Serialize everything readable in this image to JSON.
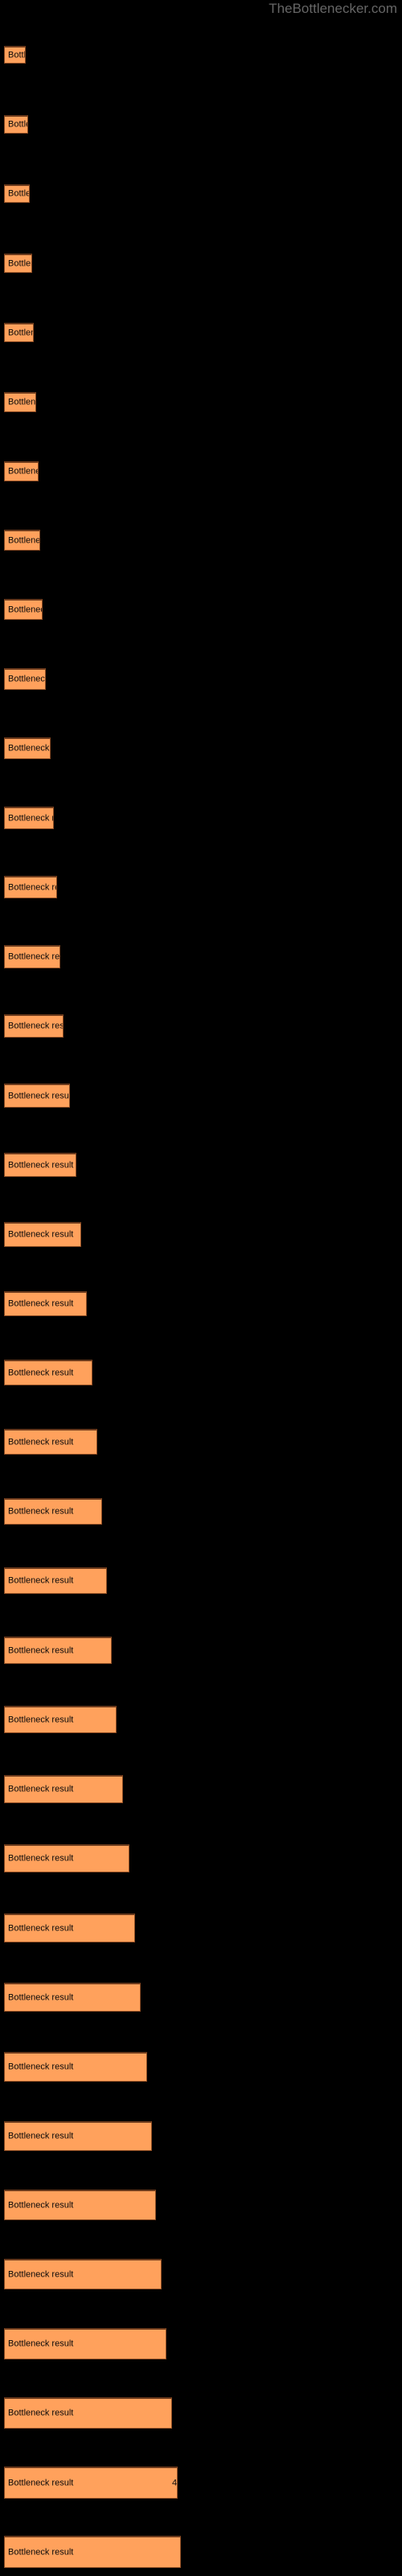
{
  "watermark": "TheBottlenecker.com",
  "colors": {
    "background": "#000000",
    "bar_fill": "#ffa15c",
    "bar_border": "#8a4a22",
    "bar_top_border": "#6b3a1c",
    "label_text": "#0a0a0a",
    "watermark_text": "#666666"
  },
  "chart_data": {
    "type": "bar",
    "orientation": "horizontal",
    "title": "",
    "subtitle": "",
    "xlabel": "",
    "ylabel": "",
    "grid": false,
    "legend": null,
    "axis_labels_visible": false,
    "categories": [
      "Bottleneck result",
      "Bottleneck result",
      "Bottleneck result",
      "Bottleneck result",
      "Bottleneck result",
      "Bottleneck result",
      "Bottleneck result",
      "Bottleneck result",
      "Bottleneck result",
      "Bottleneck result",
      "Bottleneck result",
      "Bottleneck result",
      "Bottleneck result",
      "Bottleneck result",
      "Bottleneck result",
      "Bottleneck result",
      "Bottleneck result",
      "Bottleneck result",
      "Bottleneck result",
      "Bottleneck result",
      "Bottleneck result",
      "Bottleneck result",
      "Bottleneck result",
      "Bottleneck result",
      "Bottleneck result",
      "Bottleneck result",
      "Bottleneck result",
      "Bottleneck result",
      "Bottleneck result",
      "Bottleneck result",
      "Bottleneck result",
      "Bottleneck result",
      "Bottleneck result",
      "Bottleneck result",
      "Bottleneck result",
      "Bottleneck result",
      "Bottleneck result"
    ],
    "values": [
      27,
      30,
      32,
      35,
      37,
      40,
      43,
      45,
      48,
      52,
      58,
      62,
      66,
      70,
      74,
      82,
      90,
      96,
      103,
      110,
      116,
      122,
      128,
      134,
      140,
      148,
      156,
      163,
      170,
      178,
      184,
      189,
      196,
      202,
      209,
      216,
      220
    ],
    "value_labels": [
      "",
      "",
      "",
      "",
      "",
      "",
      "",
      "",
      "",
      "",
      "",
      "",
      "",
      "",
      "",
      "",
      "",
      "",
      "",
      "",
      "",
      "",
      "",
      "",
      "",
      "",
      "",
      "",
      "",
      "",
      "",
      "",
      "",
      "",
      "",
      "4",
      ""
    ],
    "bar_tops": [
      57,
      100,
      143,
      186,
      229,
      272,
      315,
      358,
      401,
      444,
      487,
      530,
      573,
      616,
      659,
      702,
      745,
      788,
      831,
      874,
      917,
      960,
      1003,
      1046,
      1089,
      1132,
      1175,
      1218,
      1261,
      1304,
      1347,
      1390,
      1433,
      1476,
      1519,
      1562,
      1605
    ],
    "xlim": [
      0,
      240
    ],
    "ylim": null
  }
}
